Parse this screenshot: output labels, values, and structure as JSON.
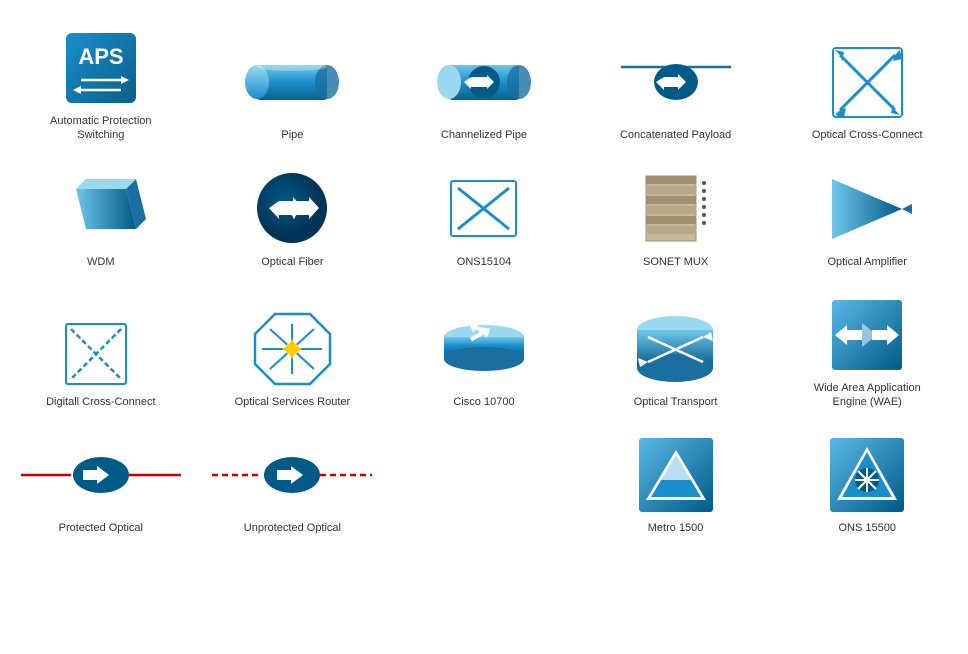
{
  "items": [
    {
      "id": "aps",
      "label": "Automatic Protection\nSwitching"
    },
    {
      "id": "pipe",
      "label": "Pipe"
    },
    {
      "id": "channelized-pipe",
      "label": "Channelized Pipe"
    },
    {
      "id": "concatenated-payload",
      "label": "Concatenated Payload"
    },
    {
      "id": "optical-cross-connect",
      "label": "Optical Cross-Connect"
    },
    {
      "id": "wdm",
      "label": "WDM"
    },
    {
      "id": "optical-fiber",
      "label": "Optical Fiber"
    },
    {
      "id": "ons15104",
      "label": "ONS15104"
    },
    {
      "id": "sonet-mux",
      "label": "SONET MUX"
    },
    {
      "id": "optical-amplifier",
      "label": "Optical Amplifier"
    },
    {
      "id": "digitall-cross-connect",
      "label": "Digitall Cross-Connect"
    },
    {
      "id": "optical-services-router",
      "label": "Optical Services Router"
    },
    {
      "id": "cisco-10700",
      "label": "Cisco 10700"
    },
    {
      "id": "optical-transport",
      "label": "Optical Transport"
    },
    {
      "id": "wae",
      "label": "Wide Area Application\nEngine (WAE)"
    },
    {
      "id": "protected-optical",
      "label": "Protected Optical"
    },
    {
      "id": "unprotected-optical",
      "label": "Unprotected Optical"
    },
    {
      "id": "empty1",
      "label": ""
    },
    {
      "id": "metro-1500",
      "label": "Metro 1500"
    },
    {
      "id": "ons-15500",
      "label": "ONS 15500"
    }
  ]
}
